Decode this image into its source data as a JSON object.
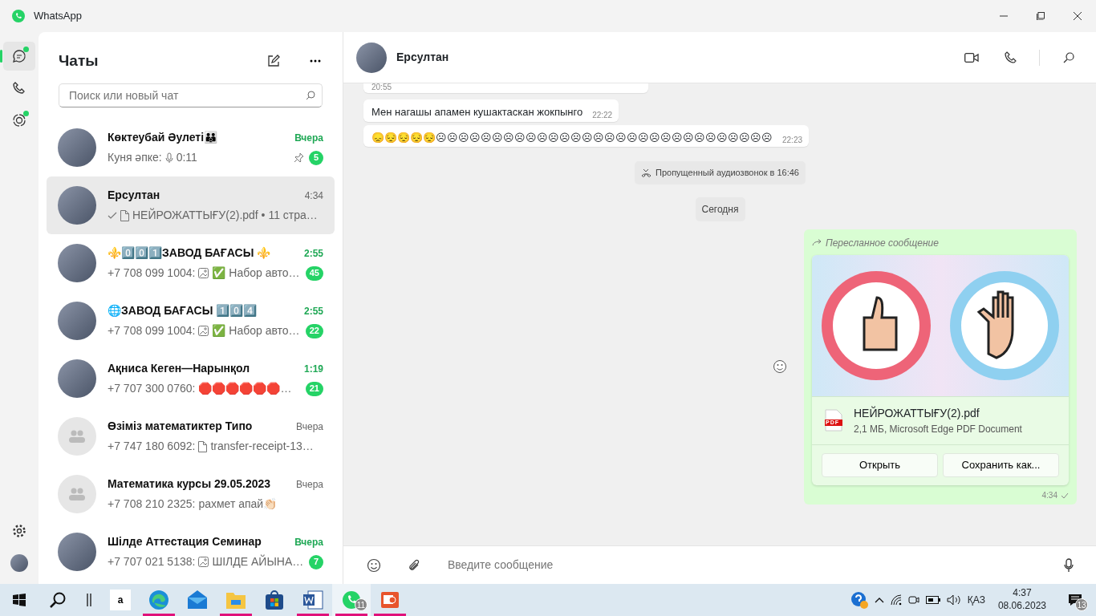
{
  "window": {
    "title": "WhatsApp"
  },
  "rail": {
    "items": [
      {
        "kind": "chats",
        "selected": true,
        "dot": true
      },
      {
        "kind": "calls",
        "selected": false,
        "dot": false
      },
      {
        "kind": "status",
        "selected": false,
        "dot": true
      }
    ]
  },
  "chat_list": {
    "title": "Чаты",
    "search": {
      "placeholder": "Поиск или новый чат"
    },
    "chats": [
      {
        "name": "Көктеубай Әулеті👪",
        "time": "Вчера",
        "has_photo": true,
        "sent": false,
        "sender": "Куня әпке:",
        "kind": "voice",
        "text": "0:11",
        "pinned": true,
        "unread": "5",
        "selected": false
      },
      {
        "name": "Ерсултан",
        "time": "4:34",
        "has_photo": true,
        "sent": true,
        "kind": "document",
        "text": "НЕЙРОЖАТТЫҒУ(2).pdf • 11 стра…",
        "pinned": false,
        "selected": true
      },
      {
        "name": "⚜️0️⃣0️⃣1️⃣ЗАВОД БАҒАСЫ ⚜️",
        "time": "2:55",
        "has_photo": true,
        "sent": false,
        "sender": "+7 708 099 1004:",
        "kind": "image",
        "text": "✅ Набор авто…",
        "pinned": false,
        "unread": "45",
        "selected": false
      },
      {
        "name": "🌐ЗАВОД БАҒАСЫ 1️⃣0️⃣4️⃣",
        "time": "2:55",
        "has_photo": true,
        "sent": false,
        "sender": "+7 708 099 1004:",
        "kind": "image",
        "text": "✅ Набор авто…",
        "pinned": false,
        "unread": "22",
        "selected": false
      },
      {
        "name": "Ақниса Кеген—Нарынқол",
        "time": "1:19",
        "has_photo": true,
        "sent": false,
        "sender": "+7 707 300 0760:",
        "kind": "text",
        "text": "🛑🛑🛑🛑🛑🛑…",
        "pinned": false,
        "unread": "21",
        "selected": false
      },
      {
        "name": "Өзіміз математиктер Типо",
        "time": "Вчера",
        "has_photo": false,
        "sent": false,
        "sender": "+7 747 180 6092:",
        "kind": "document",
        "text": "transfer-receipt-13…",
        "pinned": false,
        "selected": false
      },
      {
        "name": "Математика курсы 29.05.2023",
        "time": "Вчера",
        "has_photo": false,
        "sent": false,
        "sender": "+7 708 210 2325:",
        "kind": "text",
        "text": "рахмет апай👏🏻",
        "pinned": false,
        "selected": false
      },
      {
        "name": "Шілде Аттестация Семинар",
        "time": "Вчера",
        "has_photo": true,
        "sent": false,
        "sender": "+7 707 021 5138:",
        "kind": "image",
        "text": "ШІЛДЕ АЙЫНА…",
        "pinned": false,
        "unread": "7",
        "selected": false
      }
    ]
  },
  "conversation": {
    "contact": "Ерсултан",
    "messages": [
      {
        "kind": "time_only",
        "time": "20:55"
      },
      {
        "kind": "incoming",
        "text": "Мен нагашы апамен  кушактаскан жокпынго",
        "time": "22:22"
      },
      {
        "kind": "incoming",
        "text": "😞😔😔😔😔☹☹☹☹☹☹☹☹☹☹☹☹☹☹☹☹☹☹☹☹☹☹☹☹☹☹☹☹☹☹",
        "time": "22:23"
      },
      {
        "kind": "missed_call",
        "text": "Пропущенный аудиозвонок в 16:46"
      },
      {
        "kind": "date",
        "text": "Сегодня"
      },
      {
        "kind": "document",
        "forwarded": "Пересланное сообщение",
        "filename": "НЕЙРОЖАТТЫҒУ(2).pdf",
        "meta": "2,1 МБ, Microsoft Edge PDF Document",
        "file_badge": "PDF",
        "buttons": [
          "Открыть",
          "Сохранить как..."
        ],
        "time": "4:34",
        "sent": true
      }
    ],
    "composer": {
      "placeholder": "Введите сообщение"
    }
  },
  "taskbar": {
    "apps": [
      {
        "kind": "amazon",
        "label": "a",
        "running": false,
        "active": false
      },
      {
        "kind": "edge",
        "running": true,
        "active": false
      },
      {
        "kind": "mail",
        "running": false,
        "active": false
      },
      {
        "kind": "explorer",
        "running": true,
        "active": false
      },
      {
        "kind": "store",
        "running": false,
        "active": false
      },
      {
        "kind": "word",
        "running": true,
        "active": false
      },
      {
        "kind": "whatsapp",
        "running": true,
        "active": true,
        "badge": "11"
      },
      {
        "kind": "slides",
        "running": true,
        "active": false
      }
    ],
    "language": "ҚАЗ",
    "time": "4:37",
    "date": "08.06.2023",
    "notifications": "13"
  }
}
